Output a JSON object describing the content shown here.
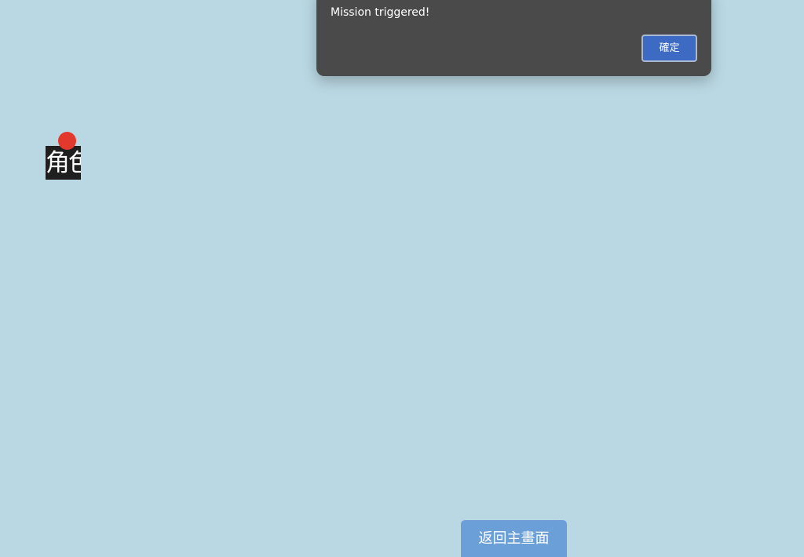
{
  "dialog": {
    "message": "Mission triggered!",
    "ok_label": "確定"
  },
  "sprite": {
    "label": "角色",
    "marker_color": "#e3392c"
  },
  "home_button": {
    "label": "返回主畫面"
  },
  "colors": {
    "background": "#bad8e3",
    "dialog_bg": "#4a4a4a",
    "ok_button": "#3d6ac3",
    "home_button": "#6a9fd8"
  }
}
